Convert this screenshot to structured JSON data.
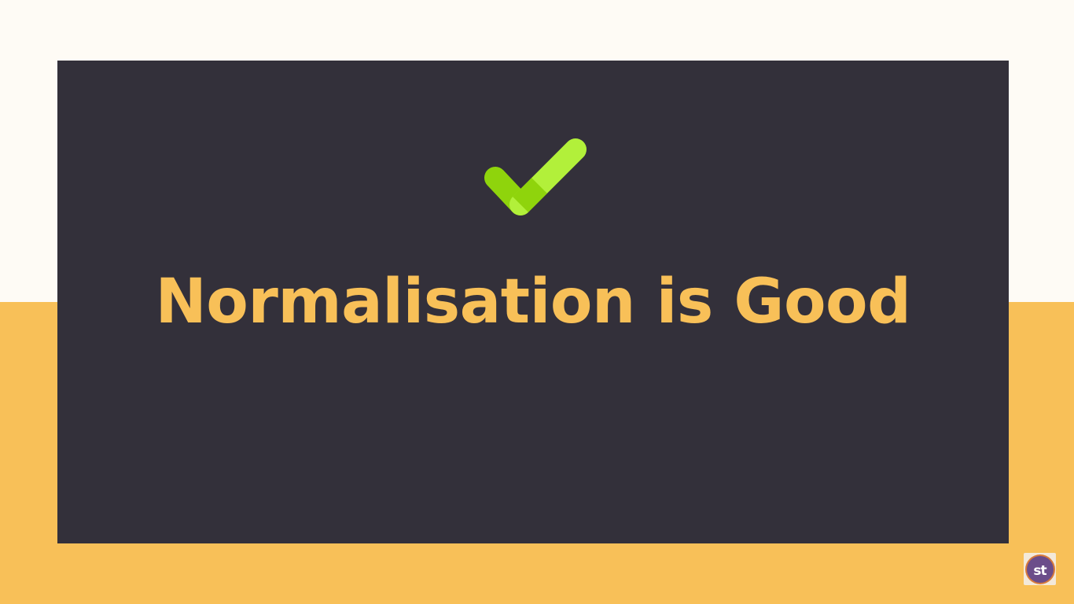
{
  "slide": {
    "headline": "Normalisation is Good",
    "icon": "checkmark-icon"
  },
  "logo": {
    "text": "st"
  },
  "colors": {
    "background_top": "#fefbf5",
    "background_bottom": "#f8c058",
    "panel": "#33303a",
    "headline": "#f8c058",
    "check_light": "#b2f03a",
    "check_dark": "#8fd40c",
    "logo_circle": "#6b4d8a"
  }
}
